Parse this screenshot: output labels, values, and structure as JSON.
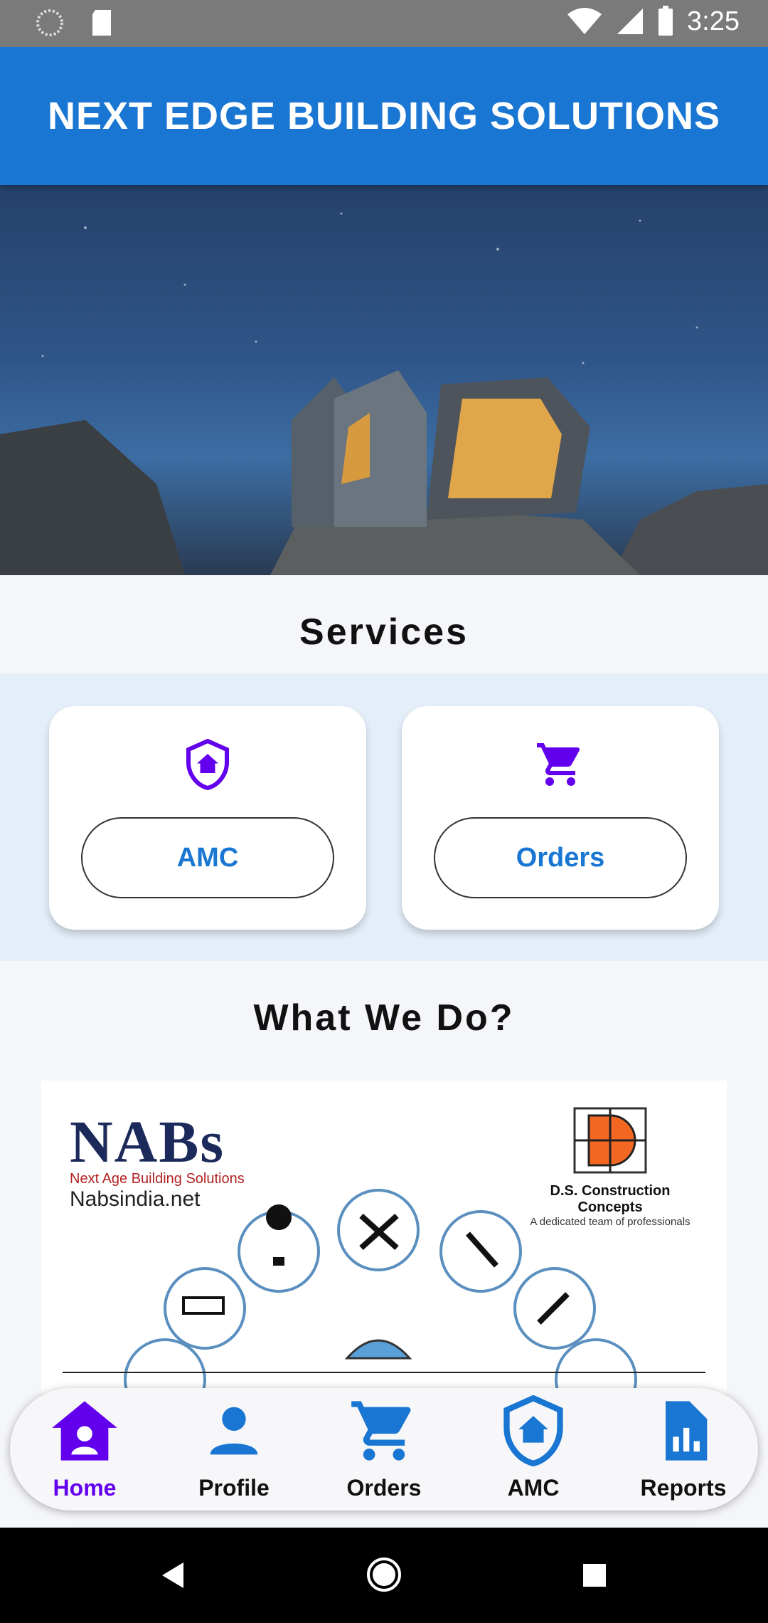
{
  "status_bar": {
    "time": "3:25",
    "icons": [
      "sync-icon",
      "sd-card-icon",
      "wifi-icon",
      "signal-icon",
      "battery-icon"
    ]
  },
  "app_bar": {
    "title": "NEXT EDGE BUILDING SOLUTIONS"
  },
  "hero": {
    "description_icon": "house-on-cliff-image"
  },
  "services": {
    "title": "Services",
    "cards": [
      {
        "icon": "shield-home-icon",
        "label": "AMC"
      },
      {
        "icon": "cart-icon",
        "label": "Orders"
      }
    ]
  },
  "what_we_do": {
    "title": "What We Do?",
    "image": {
      "left_logo_text": "NABs",
      "left_logo_subtitle": "Next Age Building Solutions",
      "left_logo_site": "Nabsindia.net",
      "right_logo_name": "D.S. Construction Concepts",
      "right_logo_tagline": "A dedicated team of professionals"
    }
  },
  "bottom_nav": {
    "items": [
      {
        "label": "Home",
        "icon": "home-icon",
        "active": true
      },
      {
        "label": "Profile",
        "icon": "person-icon",
        "active": false
      },
      {
        "label": "Orders",
        "icon": "cart-icon",
        "active": false
      },
      {
        "label": "AMC",
        "icon": "shield-home-icon",
        "active": false
      },
      {
        "label": "Reports",
        "icon": "report-icon",
        "active": false
      }
    ]
  },
  "colors": {
    "primary": "#1976d2",
    "accent": "#6200ee",
    "status_bar": "#7a7a7a"
  }
}
